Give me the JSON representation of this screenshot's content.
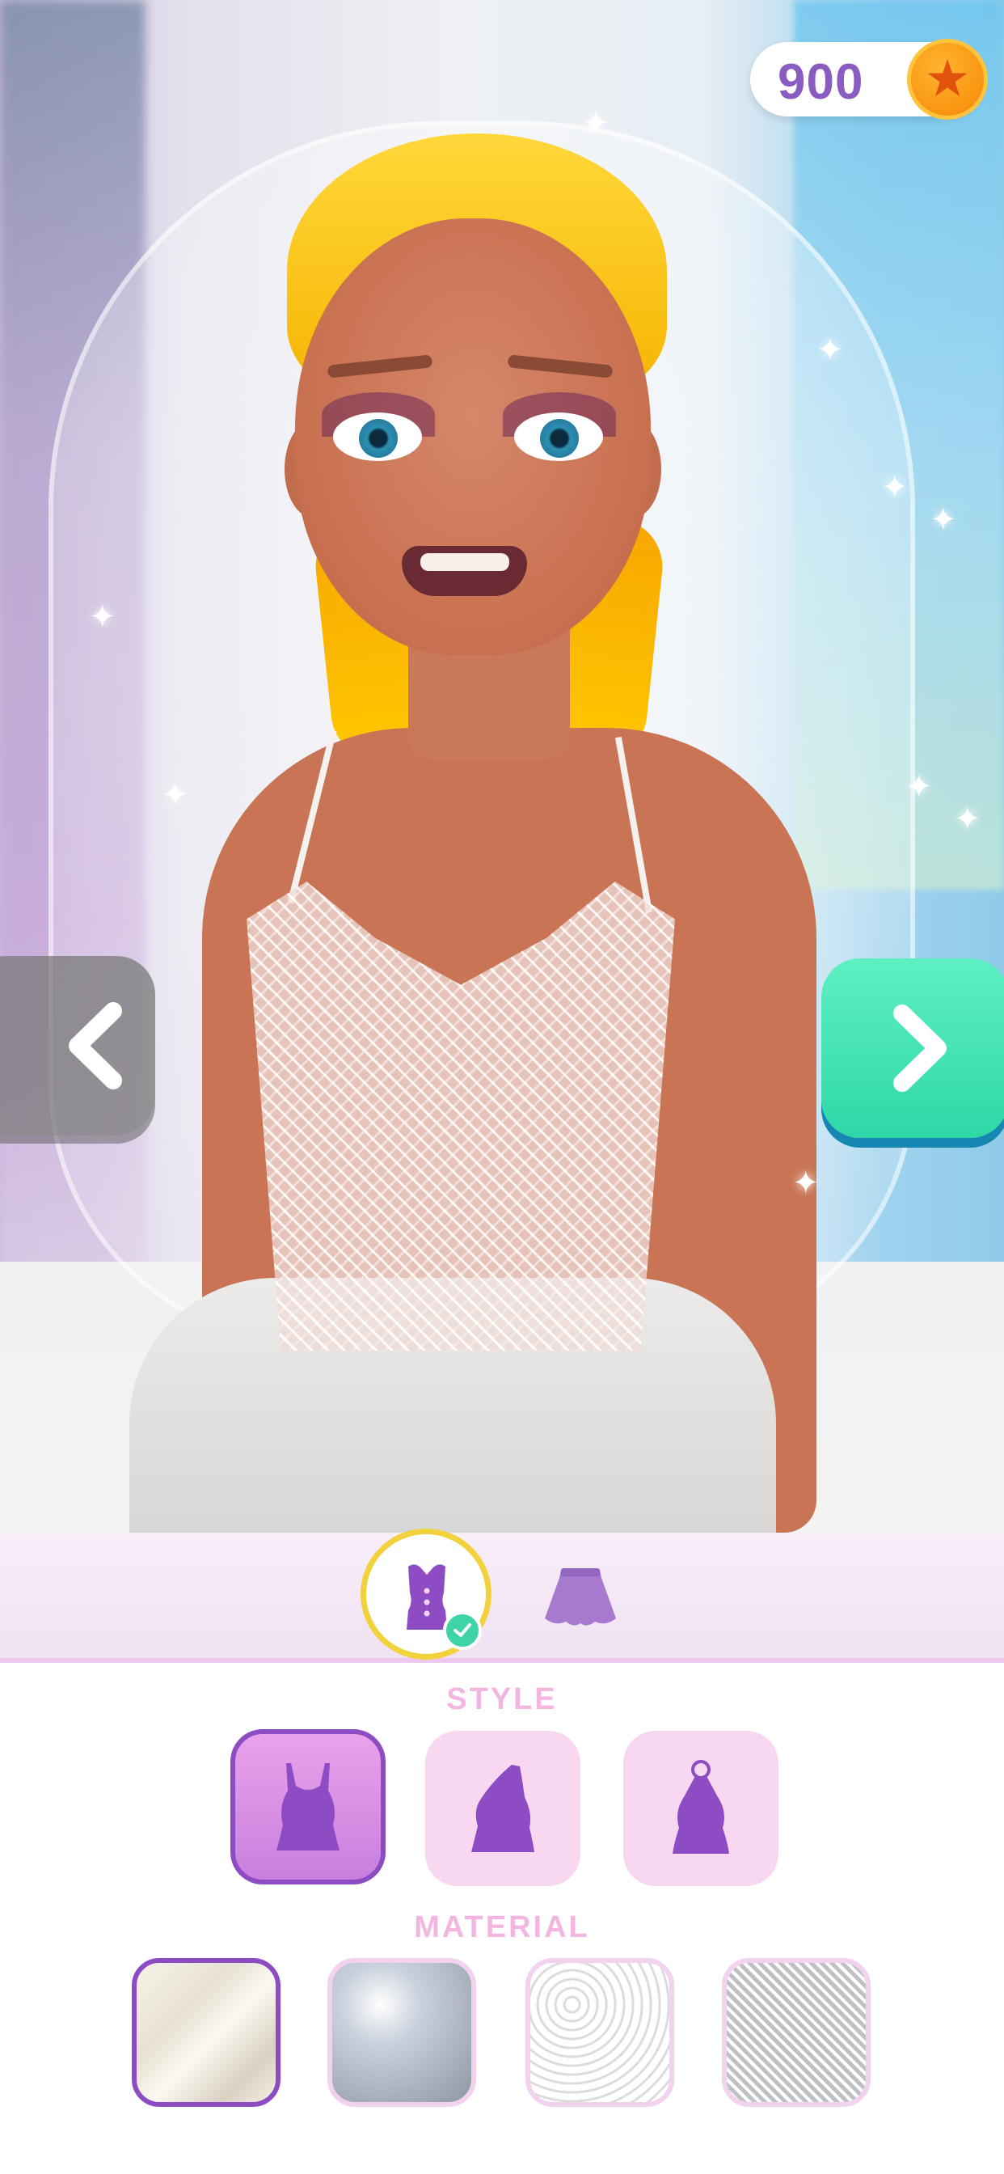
{
  "hud": {
    "coins": "900",
    "coin_icon": "star-coin-icon"
  },
  "navigation": {
    "prev_icon": "chevron-left-icon",
    "next_icon": "chevron-right-icon"
  },
  "categories": {
    "items": [
      {
        "icon": "corset-icon",
        "selected": true,
        "completed": true
      },
      {
        "icon": "skirt-icon",
        "selected": false
      }
    ]
  },
  "style_section": {
    "label": "STYLE",
    "options": [
      {
        "icon": "camisole-top-icon",
        "selected": true
      },
      {
        "icon": "one-shoulder-top-icon",
        "selected": false
      },
      {
        "icon": "halter-top-icon",
        "selected": false
      }
    ]
  },
  "material_section": {
    "label": "MATERIAL",
    "options": [
      {
        "icon": "silk-swatch",
        "selected": true
      },
      {
        "icon": "satin-swatch",
        "selected": false
      },
      {
        "icon": "lace-swatch",
        "selected": false
      },
      {
        "icon": "mesh-lace-swatch",
        "selected": false
      }
    ]
  },
  "colors": {
    "accent_purple": "#8d4cc4",
    "next_button": "#2fd7a6",
    "label_pink": "#f3b6e1",
    "selected_ring": "#f2d23c"
  }
}
